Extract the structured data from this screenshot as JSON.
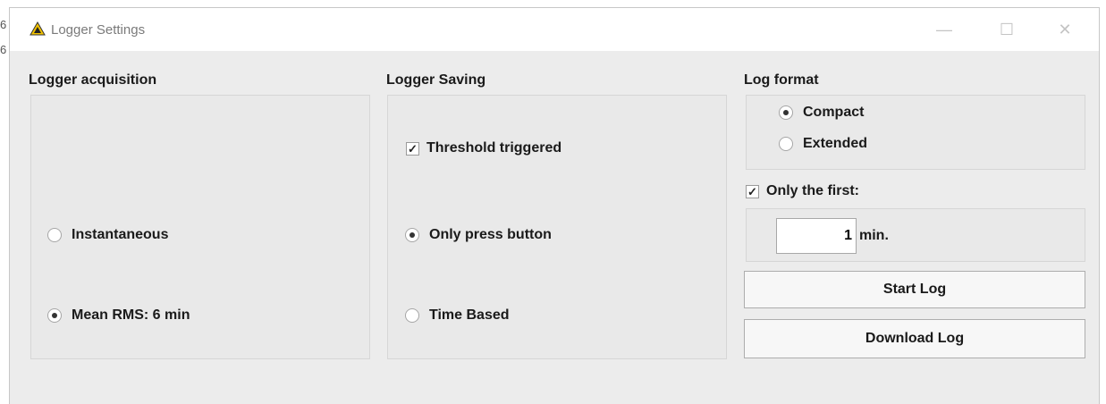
{
  "window": {
    "title": "Logger Settings"
  },
  "acquisition": {
    "label": "Logger acquisition",
    "options": [
      {
        "label": "Instantaneous",
        "selected": false
      },
      {
        "label": "Mean RMS: 6 min",
        "selected": true
      }
    ]
  },
  "saving": {
    "label": "Logger Saving",
    "threshold_label": "Threshold triggered",
    "threshold_checked": true,
    "options": [
      {
        "label": "Only press button",
        "selected": true
      },
      {
        "label": "Time Based",
        "selected": false
      }
    ]
  },
  "format": {
    "label": "Log format",
    "options": [
      {
        "label": "Compact",
        "selected": true
      },
      {
        "label": "Extended",
        "selected": false
      }
    ],
    "only_first_label": "Only the first:",
    "only_first_checked": true,
    "minutes_value": "1",
    "minutes_unit": "min."
  },
  "buttons": {
    "start": "Start Log",
    "download": "Download Log"
  },
  "colors": {
    "warning_icon": "#f2c200"
  }
}
